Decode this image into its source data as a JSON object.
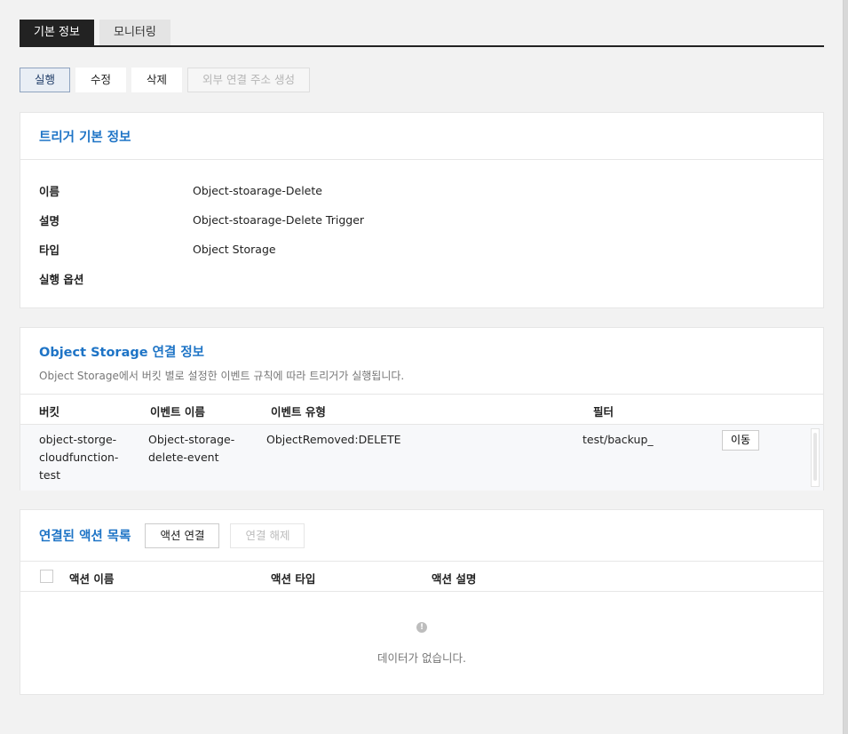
{
  "tabs": [
    {
      "label": "기본 정보",
      "active": true
    },
    {
      "label": "모니터링",
      "active": false
    }
  ],
  "toolbar": {
    "run_label": "실행",
    "edit_label": "수정",
    "delete_label": "삭제",
    "external_url_label": "외부 연결 주소 생성"
  },
  "trigger_info": {
    "title": "트리거 기본 정보",
    "rows": [
      {
        "label": "이름",
        "value": "Object-stoarage-Delete"
      },
      {
        "label": "설명",
        "value": "Object-stoarage-Delete Trigger"
      },
      {
        "label": "타입",
        "value": "Object Storage"
      },
      {
        "label": "실행 옵션",
        "value": ""
      }
    ]
  },
  "storage_info": {
    "title": "Object Storage 연결 정보",
    "subtitle": "Object Storage에서 버킷 별로 설정한 이벤트 규칙에 따라 트리거가 실행됩니다.",
    "columns": {
      "bucket": "버킷",
      "event_name": "이벤트 이름",
      "event_type": "이벤트 유형",
      "filter": "필터"
    },
    "row": {
      "bucket": "object-storge-\ncloudfunction-\ntest",
      "event_name": "Object-storage-\ndelete-event",
      "event_type": "ObjectRemoved:DELETE",
      "filter": "test/backup_",
      "move_label": "이동"
    }
  },
  "actions": {
    "title": "연결된 액션 목록",
    "connect_label": "액션 연결",
    "disconnect_label": "연결 해제",
    "columns": {
      "name": "액션 이름",
      "type": "액션 타입",
      "description": "액션 설명"
    },
    "empty_icon": "!",
    "empty_text": "데이터가 없습니다."
  },
  "colors": {
    "accent": "#1e74c6",
    "tab_active": "#222222"
  }
}
